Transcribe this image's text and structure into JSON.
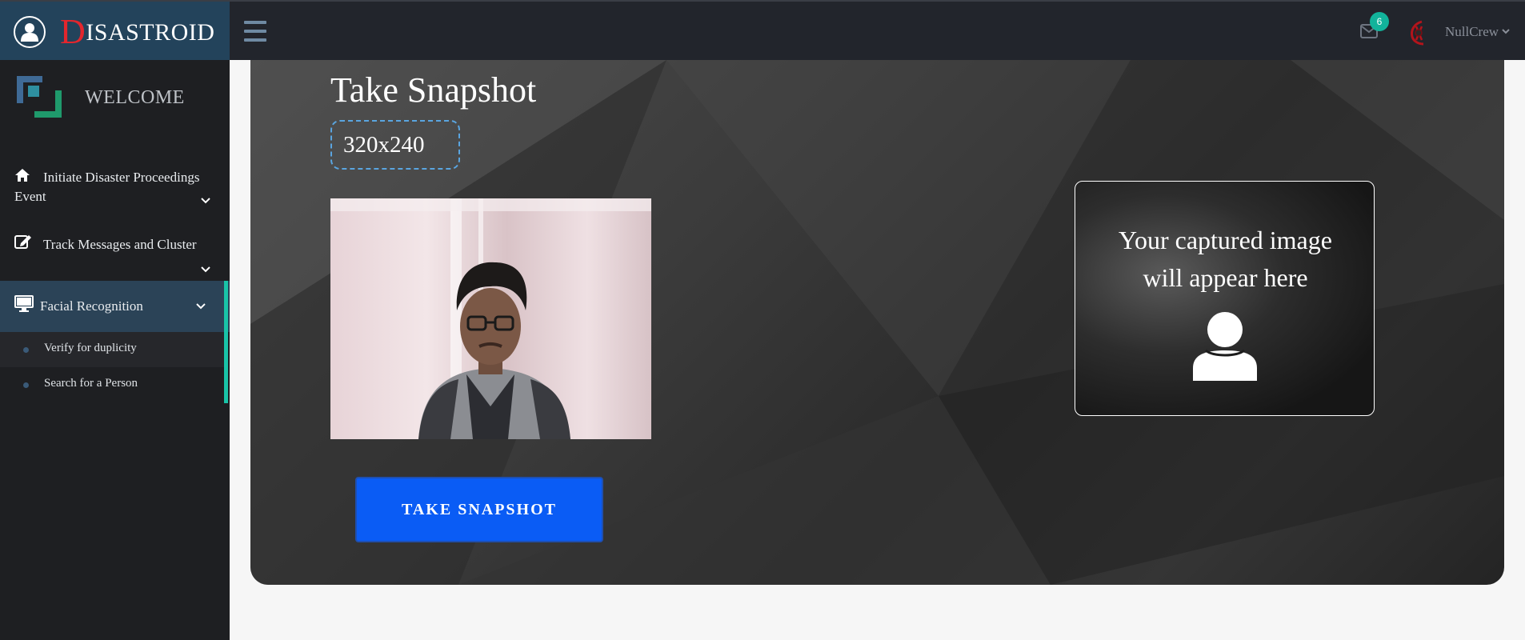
{
  "header": {
    "brand_first_letter": "D",
    "brand_rest": "ISASTROID",
    "menu_icon": "hamburger-icon",
    "mail_icon": "envelope-icon",
    "notification_count": "6",
    "user_name": "NullCrew"
  },
  "sidebar": {
    "welcome": "WELCOME",
    "items": [
      {
        "label": "Initiate Disaster Proceedings Event",
        "icon": "home-icon"
      },
      {
        "label": "Track Messages and Cluster",
        "icon": "edit-icon"
      },
      {
        "label": "Facial Recognition",
        "icon": "monitor-icon"
      }
    ],
    "sub_items": [
      {
        "label": "Verify for duplicity"
      },
      {
        "label": "Search for a Person"
      }
    ]
  },
  "main": {
    "title": "Take Snapshot",
    "resolution": "320x240",
    "snapshot_button": "TAKE SNAPSHOT",
    "placeholder_line1": "Your captured image",
    "placeholder_line2": "will appear here"
  },
  "colors": {
    "brand_bg": "#23435b",
    "brand_accent": "#e4262d",
    "badge": "#12b39b",
    "sidebar_active": "#2b4357",
    "sidebar_accent": "#19c4a8",
    "button": "#0a5cf5",
    "dashed_border": "#5aa5e0"
  }
}
